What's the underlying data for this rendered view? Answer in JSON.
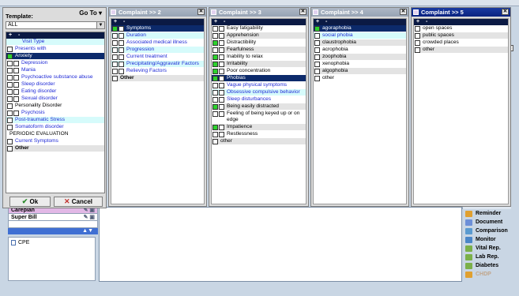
{
  "template": {
    "label": "Template:",
    "goto": "Go To ▾",
    "filter": "ALL",
    "pm": "+ -",
    "items": [
      {
        "text": "Visit Type",
        "style": "cyan",
        "cb": 0
      },
      {
        "text": "Presents with",
        "style": "white",
        "cb": 1,
        "on": [
          false
        ]
      },
      {
        "text": "Anxiety",
        "style": "dark",
        "cb": 1,
        "on": [
          true
        ]
      },
      {
        "text": "Depression",
        "style": "white",
        "cb": 2,
        "on": [
          false,
          false
        ]
      },
      {
        "text": "Mania",
        "style": "white",
        "cb": 2,
        "on": [
          false,
          false
        ]
      },
      {
        "text": "Psychoactive substance abuse",
        "style": "white",
        "cb": 2,
        "on": [
          false,
          false
        ]
      },
      {
        "text": "Sleep disorder",
        "style": "white",
        "cb": 2,
        "on": [
          false,
          false
        ]
      },
      {
        "text": "Eating disorder",
        "style": "white",
        "cb": 2,
        "on": [
          false,
          false
        ]
      },
      {
        "text": "Sexual disorder",
        "style": "white",
        "cb": 2,
        "on": [
          false,
          false
        ]
      },
      {
        "text": "Personality Disorder",
        "style": "blk",
        "cb": 1,
        "on": [
          false
        ]
      },
      {
        "text": "Psychosis",
        "style": "white",
        "cb": 2,
        "on": [
          false,
          false
        ]
      },
      {
        "text": "Post-traumatic Stress",
        "style": "cyan",
        "cb": 1,
        "on": [
          false
        ]
      },
      {
        "text": "Somatoform disorder",
        "style": "white",
        "cb": 1,
        "on": [
          false
        ]
      },
      {
        "text": "PERIODIC EVALUATION",
        "style": "sec",
        "cb": 0
      },
      {
        "text": "Current Symptoms",
        "style": "white",
        "cb": 1,
        "on": [
          false
        ]
      },
      {
        "text": "Other",
        "style": "gray",
        "cb": 1,
        "on": [
          false
        ],
        "bold": true
      }
    ],
    "ok": "Ok",
    "cancel": "Cancel"
  },
  "panels": [
    {
      "title": "Complaint >> 2",
      "active": false,
      "items": [
        {
          "text": "Symptoms",
          "style": "dark",
          "on": [
            true,
            false
          ]
        },
        {
          "text": "Duration",
          "style": "cyan",
          "on": [
            false,
            false
          ]
        },
        {
          "text": "Associated medical illness",
          "style": "white",
          "on": [
            false,
            false
          ]
        },
        {
          "text": "Progression",
          "style": "cyan",
          "on": [
            false,
            false
          ]
        },
        {
          "text": "Current treatment",
          "style": "white",
          "on": [
            false,
            false
          ]
        },
        {
          "text": "Precipitating/Aggravatir Factors",
          "style": "cyan",
          "on": [
            false,
            false
          ]
        },
        {
          "text": "Relieving Factors",
          "style": "white",
          "on": [
            false,
            false
          ]
        },
        {
          "text": "Other",
          "style": "gray",
          "on": [
            false
          ],
          "bold": true
        }
      ]
    },
    {
      "title": "Complaint >> 3",
      "active": false,
      "items": [
        {
          "text": "Easy fatigability",
          "style": "blk",
          "on": [
            false,
            false
          ]
        },
        {
          "text": "Apprehension",
          "style": "gray",
          "on": [
            false,
            false
          ]
        },
        {
          "text": "Distractibility",
          "style": "blk",
          "on": [
            true,
            false
          ]
        },
        {
          "text": "Fearfulness",
          "style": "gray",
          "on": [
            false,
            false
          ]
        },
        {
          "text": "Inability to relax",
          "style": "blk",
          "on": [
            true,
            false
          ]
        },
        {
          "text": "Irritability",
          "style": "gray",
          "on": [
            true,
            false
          ]
        },
        {
          "text": "Poor concentration",
          "style": "blk",
          "on": [
            true,
            false
          ]
        },
        {
          "text": "Phobias",
          "style": "dark",
          "on": [
            true,
            false
          ]
        },
        {
          "text": "Vague physical symptoms",
          "style": "white",
          "on": [
            false,
            false
          ]
        },
        {
          "text": "Obsessive compulsive behavior",
          "style": "cyan",
          "on": [
            false,
            false
          ]
        },
        {
          "text": "Sleep disturbances",
          "style": "white",
          "on": [
            false,
            false
          ]
        },
        {
          "text": "Being easily distracted",
          "style": "gray",
          "on": [
            true,
            false
          ]
        },
        {
          "text": "Feeling of being keyed up or on edge",
          "style": "blk",
          "on": [
            false,
            false
          ]
        },
        {
          "text": "Impatience",
          "style": "gray",
          "on": [
            true,
            false
          ]
        },
        {
          "text": "Restlessness",
          "style": "blk",
          "on": [
            false,
            false
          ]
        },
        {
          "text": "other",
          "style": "gray",
          "on": [
            false
          ]
        }
      ]
    },
    {
      "title": "Complaint >> 4",
      "active": false,
      "items": [
        {
          "text": "agoraphobia",
          "style": "dark",
          "on": [
            true
          ]
        },
        {
          "text": "social phobia",
          "style": "cyan",
          "on": [
            false
          ]
        },
        {
          "text": "claustrophobia",
          "style": "gray",
          "on": [
            false
          ]
        },
        {
          "text": "acrophobia",
          "style": "blk",
          "on": [
            false
          ]
        },
        {
          "text": "zoophobia",
          "style": "gray",
          "on": [
            false
          ]
        },
        {
          "text": "xenophobia",
          "style": "blk",
          "on": [
            false
          ]
        },
        {
          "text": "algophobia",
          "style": "gray",
          "on": [
            false
          ]
        },
        {
          "text": "other",
          "style": "blk",
          "on": [
            false
          ]
        }
      ]
    },
    {
      "title": "Complaint >> 5",
      "active": true,
      "items": [
        {
          "text": "open spaces",
          "style": "blk",
          "on": [
            false
          ]
        },
        {
          "text": "public spaces",
          "style": "gray",
          "on": [
            false
          ]
        },
        {
          "text": "crowded places",
          "style": "blk",
          "on": [
            false
          ]
        },
        {
          "text": "other",
          "style": "gray",
          "on": [
            false
          ]
        }
      ]
    }
  ],
  "lower_left": {
    "careplan": "Careplan",
    "superbill": "Super Bill",
    "cpe": "CPE"
  },
  "right_buttons": [
    {
      "label": "Reminder",
      "icon": "reminder-icon",
      "color": "#e0a030",
      "disabled": false
    },
    {
      "label": "Document",
      "icon": "document-icon",
      "color": "#6c8fd8",
      "disabled": false
    },
    {
      "label": "Comparison",
      "icon": "comparison-icon",
      "color": "#5a9ad0",
      "disabled": false
    },
    {
      "label": "Monitor",
      "icon": "monitor-icon",
      "color": "#4a86c8",
      "disabled": false
    },
    {
      "label": "Vital Rep.",
      "icon": "vital-report-icon",
      "color": "#7bb04a",
      "disabled": false
    },
    {
      "label": "Lab Rep.",
      "icon": "lab-report-icon",
      "color": "#7bb04a",
      "disabled": false
    },
    {
      "label": "Diabetes",
      "icon": "diabetes-icon",
      "color": "#7bb04a",
      "disabled": false
    },
    {
      "label": "CHDP",
      "icon": "chdp-icon",
      "color": "#e0a030",
      "disabled": true
    }
  ]
}
